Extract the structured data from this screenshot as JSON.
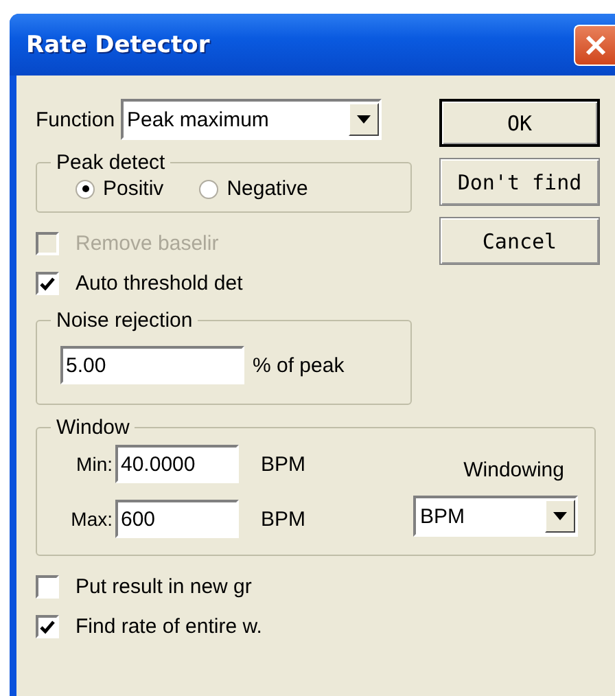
{
  "window": {
    "title": "Rate Detector"
  },
  "function": {
    "label": "Function",
    "value": "Peak maximum"
  },
  "peak_detect": {
    "title": "Peak detect",
    "options": [
      {
        "label": "Positiv",
        "selected": true
      },
      {
        "label": "Negative",
        "selected": false
      }
    ]
  },
  "options": [
    {
      "label": "Remove baselir",
      "checked": false,
      "disabled": true
    },
    {
      "label": "Auto threshold det",
      "checked": true,
      "disabled": false
    }
  ],
  "noise_rejection": {
    "title": "Noise rejection",
    "value": "5.00",
    "unit": "% of peak"
  },
  "window_group": {
    "title": "Window",
    "fields": [
      {
        "label": "Min:",
        "value": "40.0000",
        "unit": "BPM"
      },
      {
        "label": "Max:",
        "value": "600",
        "unit": "BPM"
      }
    ],
    "windowing": {
      "label": "Windowing",
      "value": "BPM"
    }
  },
  "bottom_options": [
    {
      "label": "Put result in new gr",
      "checked": false
    },
    {
      "label": "Find rate of entire w.",
      "checked": true
    }
  ],
  "buttons": [
    {
      "label": "OK",
      "default": true
    },
    {
      "label": "Don't find",
      "default": false
    },
    {
      "label": "Cancel",
      "default": false
    }
  ]
}
